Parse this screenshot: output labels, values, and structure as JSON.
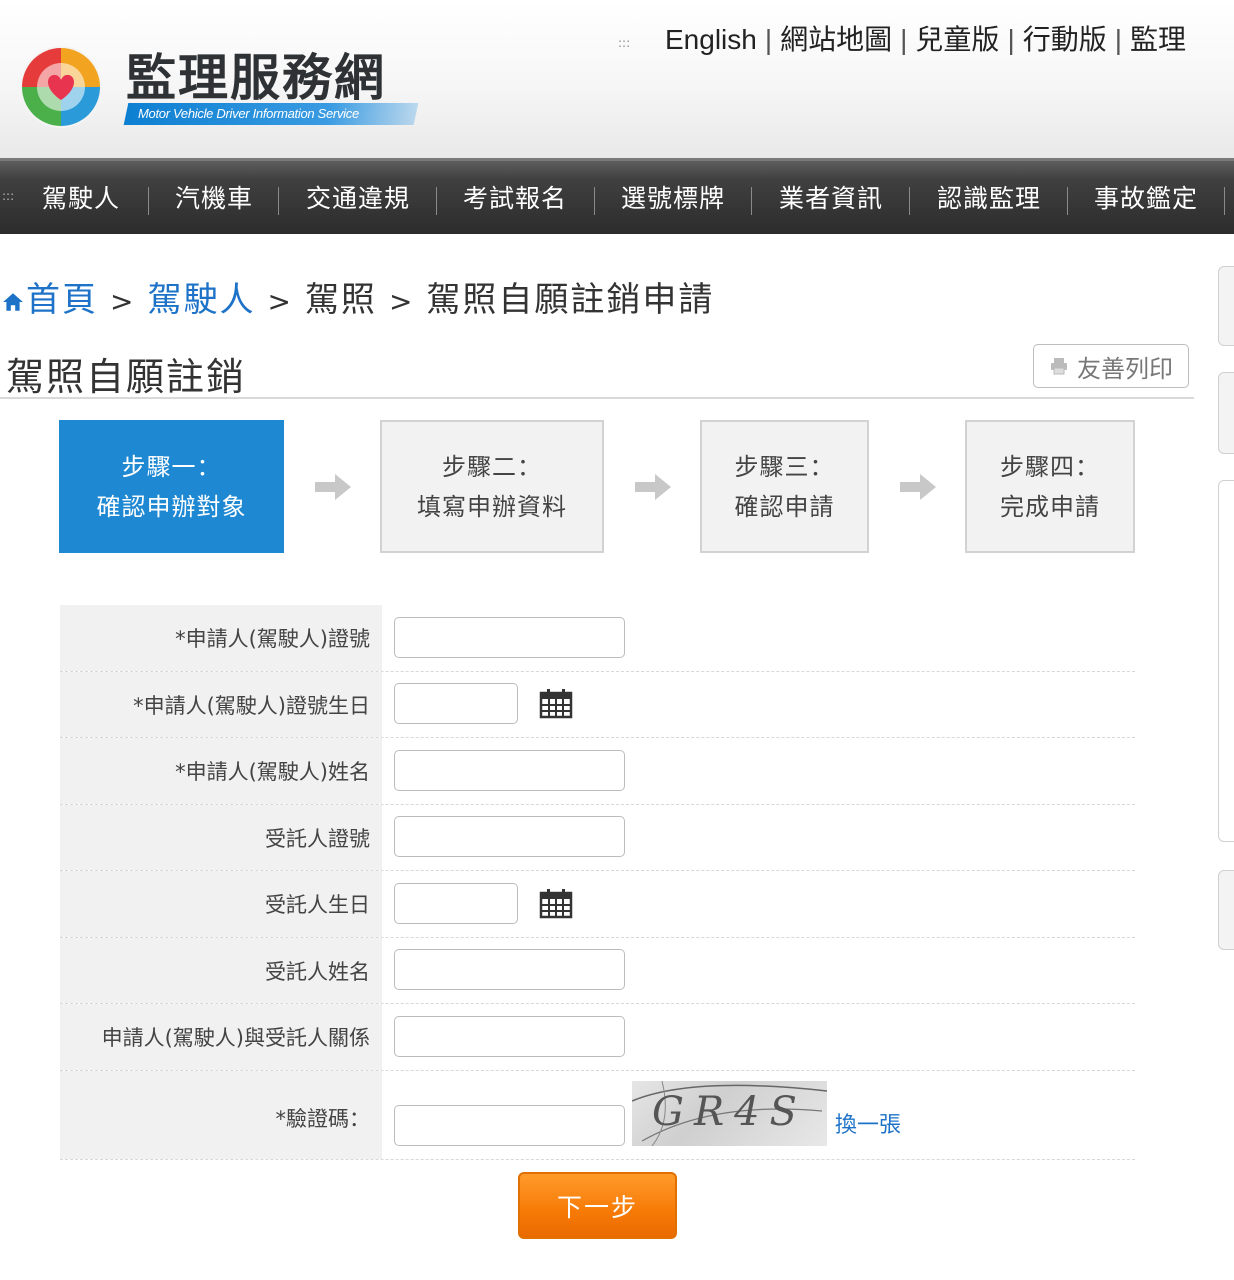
{
  "header": {
    "logo_title": "監理服務網",
    "logo_subtitle": "Motor Vehicle Driver Information Service",
    "top_dots": ":::",
    "top_links": [
      "English",
      "網站地圖",
      "兒童版",
      "行動版",
      "監理"
    ]
  },
  "nav": {
    "dots": ":::",
    "items": [
      "駕駛人",
      "汽機車",
      "交通違規",
      "考試報名",
      "選號標牌",
      "業者資訊",
      "認識監理",
      "事故鑑定"
    ]
  },
  "breadcrumb": {
    "home": "首頁",
    "level1": "駕駛人",
    "level2": "駕照",
    "current": "駕照自願註銷申請",
    "separator": ">"
  },
  "page": {
    "title": "駕照自願註銷",
    "print_label": "友善列印"
  },
  "steps": [
    {
      "line1": "步驟一：",
      "line2": "確認申辦對象",
      "active": true
    },
    {
      "line1": "步驟二：",
      "line2": "填寫申辦資料",
      "active": false
    },
    {
      "line1": "步驟三：",
      "line2": "確認申請",
      "active": false
    },
    {
      "line1": "步驟四：",
      "line2": "完成申請",
      "active": false
    }
  ],
  "form": {
    "fields": [
      {
        "label": "*申請人(駕駛人)證號",
        "value": "",
        "type": "text"
      },
      {
        "label": "*申請人(駕駛人)證號生日",
        "value": "",
        "type": "date"
      },
      {
        "label": "*申請人(駕駛人)姓名",
        "value": "",
        "type": "text"
      },
      {
        "label": "受託人證號",
        "value": "",
        "type": "text"
      },
      {
        "label": "受託人生日",
        "value": "",
        "type": "date"
      },
      {
        "label": "受託人姓名",
        "value": "",
        "type": "text"
      },
      {
        "label": "申請人(駕駛人)與受託人關係",
        "value": "",
        "type": "text"
      }
    ],
    "captcha_label": "*驗證碼：",
    "captcha_value": "",
    "captcha_image_text": "GR4S",
    "refresh_label": "換一張",
    "next_label": "下一步"
  },
  "colors": {
    "accent_blue": "#1e88d3",
    "link_blue": "#1e73c8",
    "next_orange": "#f77a06",
    "nav_dark": "#2c2c2c"
  },
  "icons": [
    "home-icon",
    "print-icon",
    "calendar-icon",
    "arrow-right-icon",
    "logo-icon"
  ]
}
